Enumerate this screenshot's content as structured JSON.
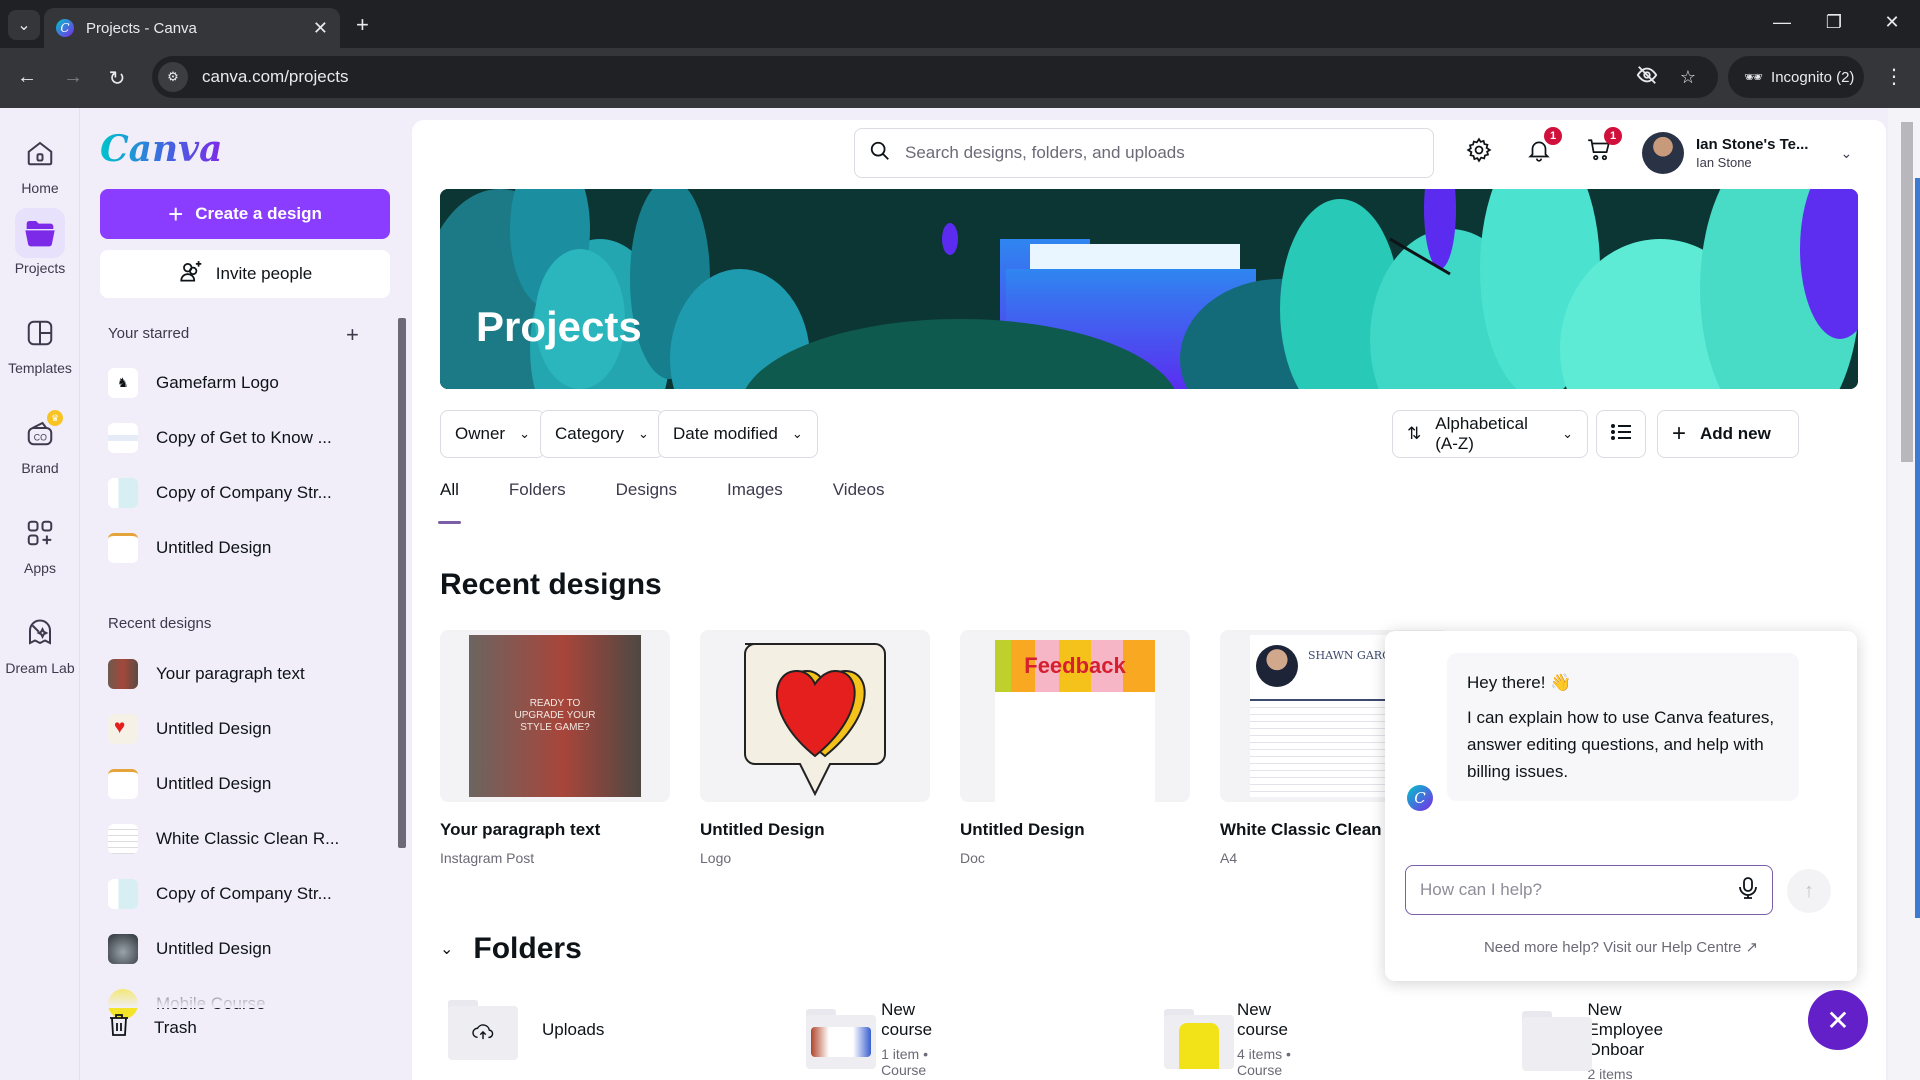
{
  "browser": {
    "tab_title": "Projects - Canva",
    "url": "canva.com/projects",
    "incognito_label": "Incognito (2)"
  },
  "rail": {
    "items": [
      {
        "label": "Home",
        "icon": "home-icon"
      },
      {
        "label": "Projects",
        "icon": "folder-icon",
        "active": true
      },
      {
        "label": "Templates",
        "icon": "templates-icon"
      },
      {
        "label": "Brand",
        "icon": "brand-icon",
        "badge": "crown"
      },
      {
        "label": "Apps",
        "icon": "apps-icon"
      },
      {
        "label": "Dream Lab",
        "icon": "dream-lab-icon"
      }
    ]
  },
  "sidebar": {
    "logo": "Canva",
    "create_label": "Create a design",
    "invite_label": "Invite people",
    "starred_title": "Your starred",
    "starred": [
      {
        "label": "Gamefarm Logo"
      },
      {
        "label": "Copy of Get to Know ..."
      },
      {
        "label": "Copy of Company Str..."
      },
      {
        "label": "Untitled Design"
      }
    ],
    "recent_title": "Recent designs",
    "recent": [
      {
        "label": "Your paragraph text"
      },
      {
        "label": "Untitled Design"
      },
      {
        "label": "Untitled Design"
      },
      {
        "label": "White Classic Clean R..."
      },
      {
        "label": "Copy of Company Str..."
      },
      {
        "label": "Untitled Design"
      },
      {
        "label": "Mobile Course"
      }
    ],
    "trash_label": "Trash"
  },
  "header": {
    "search_placeholder": "Search designs, folders, and uploads",
    "notifications_count": "1",
    "cart_count": "1",
    "account_name": "Ian Stone's Te...",
    "account_user": "Ian Stone"
  },
  "hero": {
    "title": "Projects"
  },
  "filters": {
    "owner": "Owner",
    "category": "Category",
    "date_modified": "Date modified",
    "sort": "Alphabetical (A-Z)",
    "add_new": "Add new"
  },
  "tabs": [
    {
      "label": "All",
      "active": true
    },
    {
      "label": "Folders"
    },
    {
      "label": "Designs"
    },
    {
      "label": "Images"
    },
    {
      "label": "Videos"
    }
  ],
  "recent_designs": {
    "title": "Recent designs",
    "items": [
      {
        "title": "Your paragraph text",
        "type": "Instagram Post",
        "thumb_text": "READY TO UPGRADE YOUR STYLE GAME?"
      },
      {
        "title": "Untitled Design",
        "type": "Logo"
      },
      {
        "title": "Untitled Design",
        "type": "Doc",
        "thumb_text": "Feedback"
      },
      {
        "title": "White Classic Clean",
        "type": "A4",
        "thumb_text": "SHAWN GARC"
      }
    ]
  },
  "folders": {
    "title": "Folders",
    "items": [
      {
        "name": "Uploads",
        "meta": ""
      },
      {
        "name": "New course",
        "meta": "1 item • Course"
      },
      {
        "name": "New course",
        "meta": "4 items • Course"
      },
      {
        "name": "New Employee Onboar",
        "meta": "2 items"
      }
    ]
  },
  "assistant": {
    "greeting": "Hey there! 👋",
    "message": "I can explain how to use Canva features, answer editing questions, and help with billing issues.",
    "input_placeholder": "How can I help?",
    "help_link": "Need more help? Visit our Help Centre"
  },
  "colors": {
    "brand_purple": "#8b3dff",
    "fab_purple": "#6420c8",
    "badge_red": "#d0103a"
  }
}
